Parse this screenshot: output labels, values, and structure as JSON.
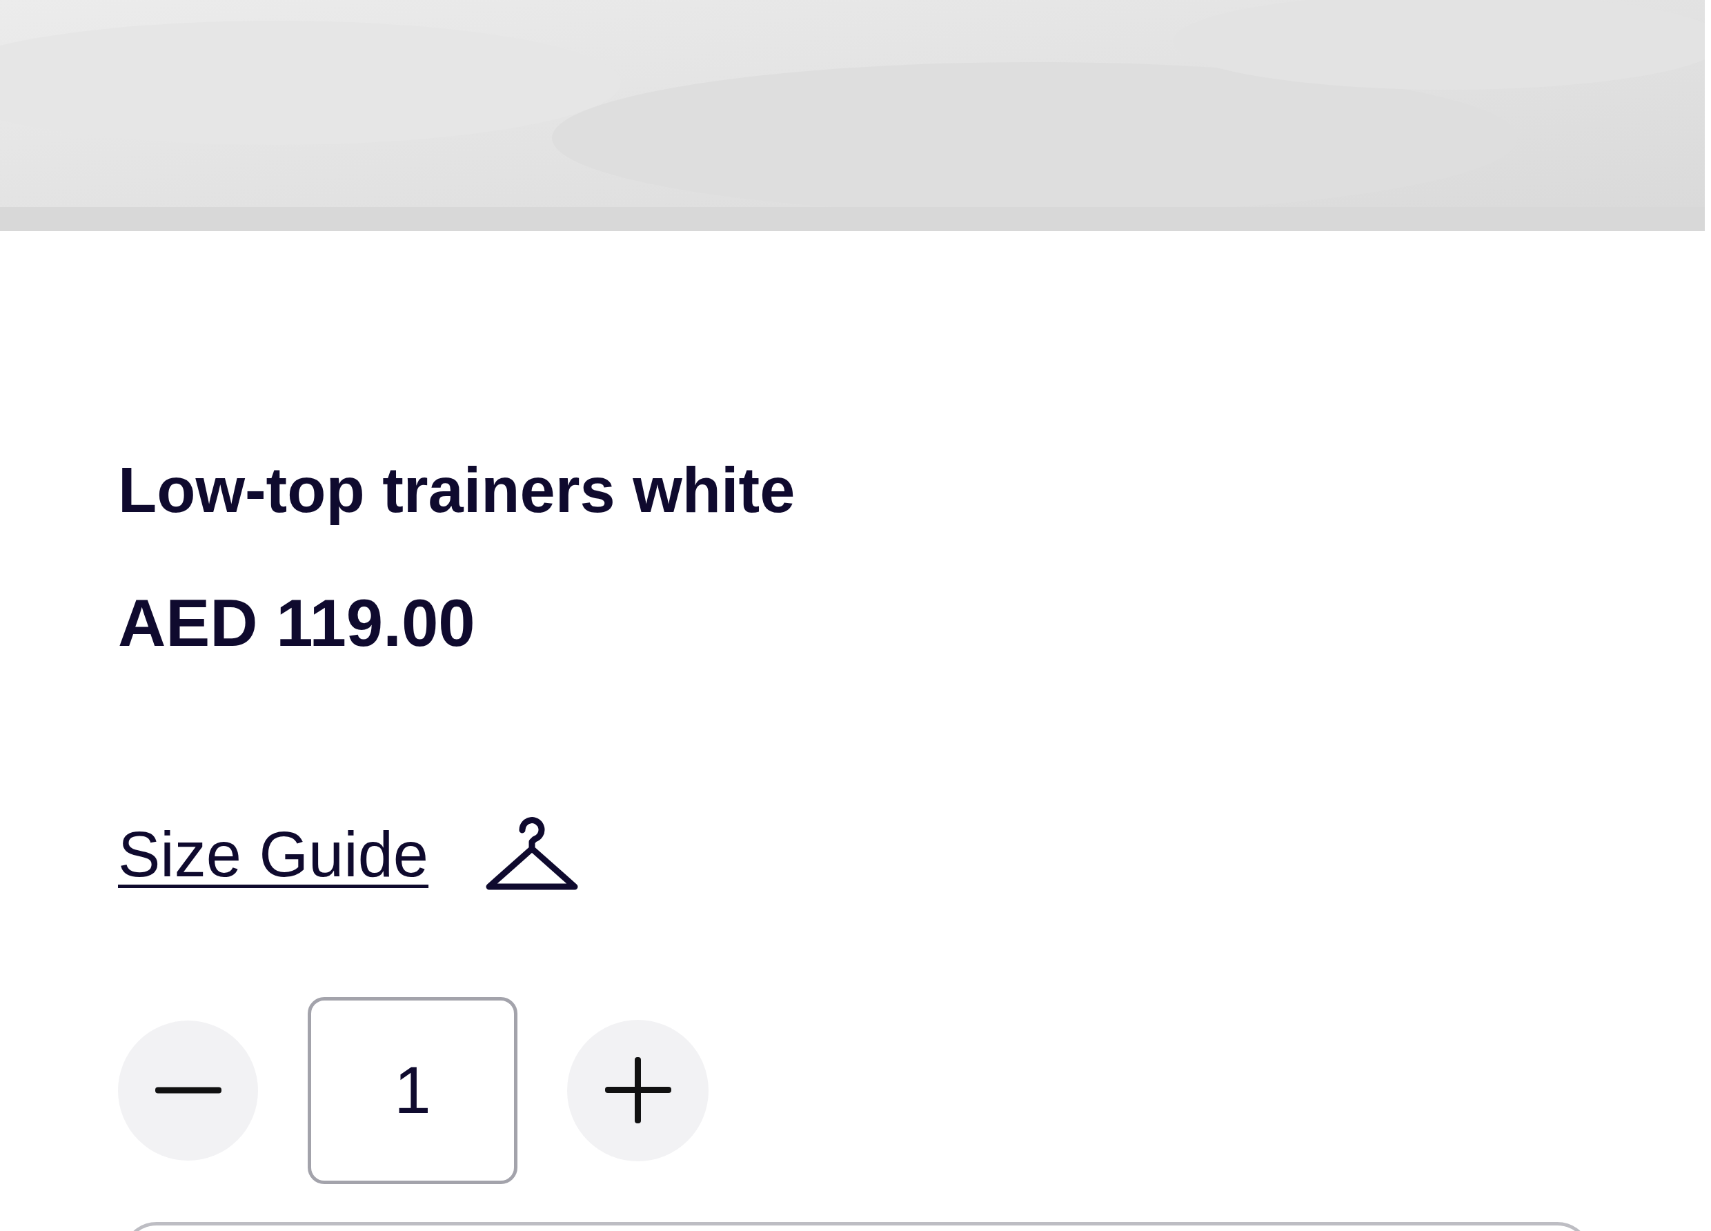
{
  "product": {
    "title": "Low-top trainers white",
    "price": "AED 119.00"
  },
  "size_guide": {
    "label": "Size Guide"
  },
  "quantity": {
    "value": "1"
  }
}
